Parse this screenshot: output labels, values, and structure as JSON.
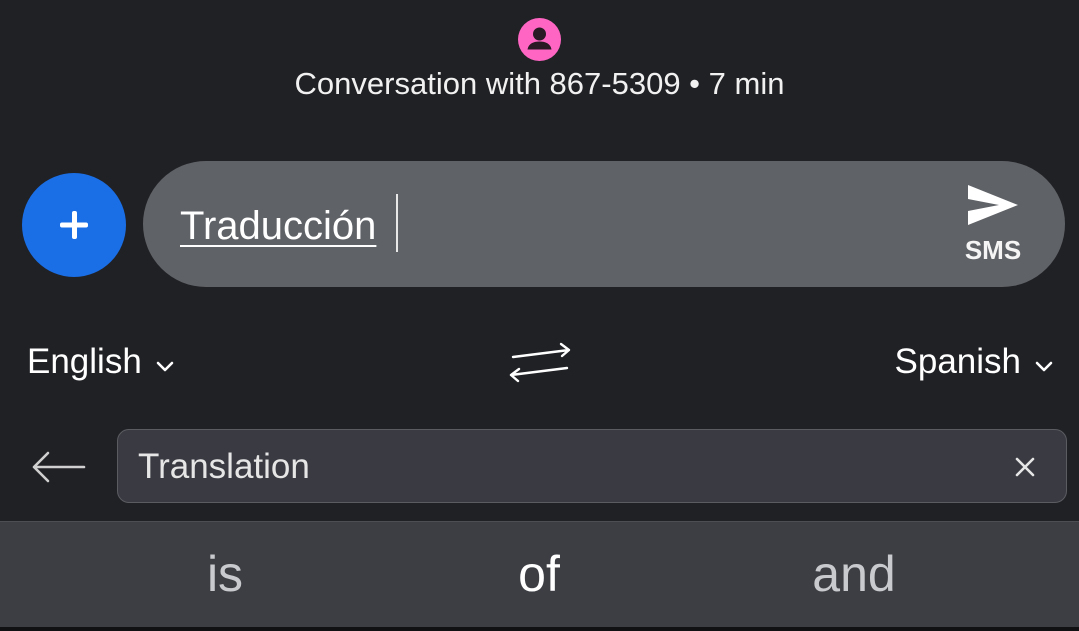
{
  "header": {
    "avatar_icon": "person-icon",
    "avatar_color": "#ff66c4",
    "title": "Conversation with 867-5309 • 7 min"
  },
  "compose": {
    "add_icon": "plus-icon",
    "add_color": "#1a6ee6",
    "message_text": "Traducción",
    "send_icon": "send-icon",
    "send_label": "SMS"
  },
  "languages": {
    "source": "English",
    "target": "Spanish",
    "swap_icon": "swap-arrows-icon",
    "dropdown_icon": "chevron-down-icon"
  },
  "translate_bar": {
    "back_icon": "arrow-left-icon",
    "value": "Translation",
    "clear_icon": "close-icon"
  },
  "suggestions": [
    "is",
    "of",
    "and"
  ]
}
